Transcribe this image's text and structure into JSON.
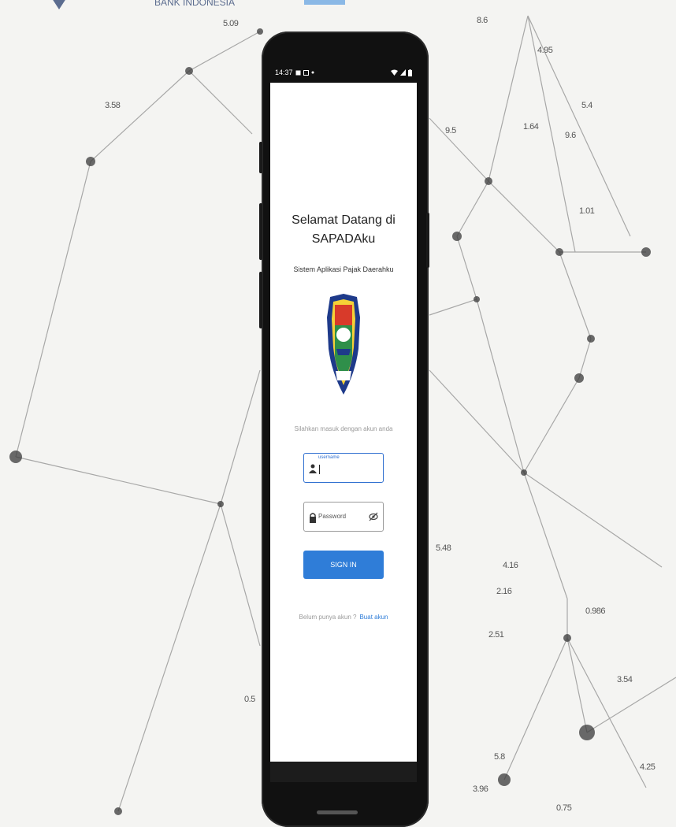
{
  "background": {
    "bank_text": "BANK INDONESIA",
    "labels": [
      "5.09",
      "8.6",
      "3.58",
      "4.95",
      "5.4",
      "9.6",
      "1.01",
      "1.64",
      "9.5",
      "4.16",
      "2.16",
      "5.48",
      "2.51",
      "0.5",
      "5.8",
      "3.96",
      "0.75",
      "4.25",
      "3.54",
      "0.986"
    ]
  },
  "statusbar": {
    "time": "14:37"
  },
  "app": {
    "welcome_line1": "Selamat Datang di",
    "welcome_line2": "SAPADAku",
    "subtitle": "Sistem Aplikasi Pajak Daerahku",
    "prompt": "Silahkan masuk dengan akun anda",
    "username_label": "username",
    "password_placeholder": "Password",
    "signin_label": "SIGN IN",
    "register_text": "Belum punya akun ?",
    "register_link": "Buat akun"
  },
  "colors": {
    "accent": "#2f7dd8",
    "phone_body": "#111111"
  }
}
